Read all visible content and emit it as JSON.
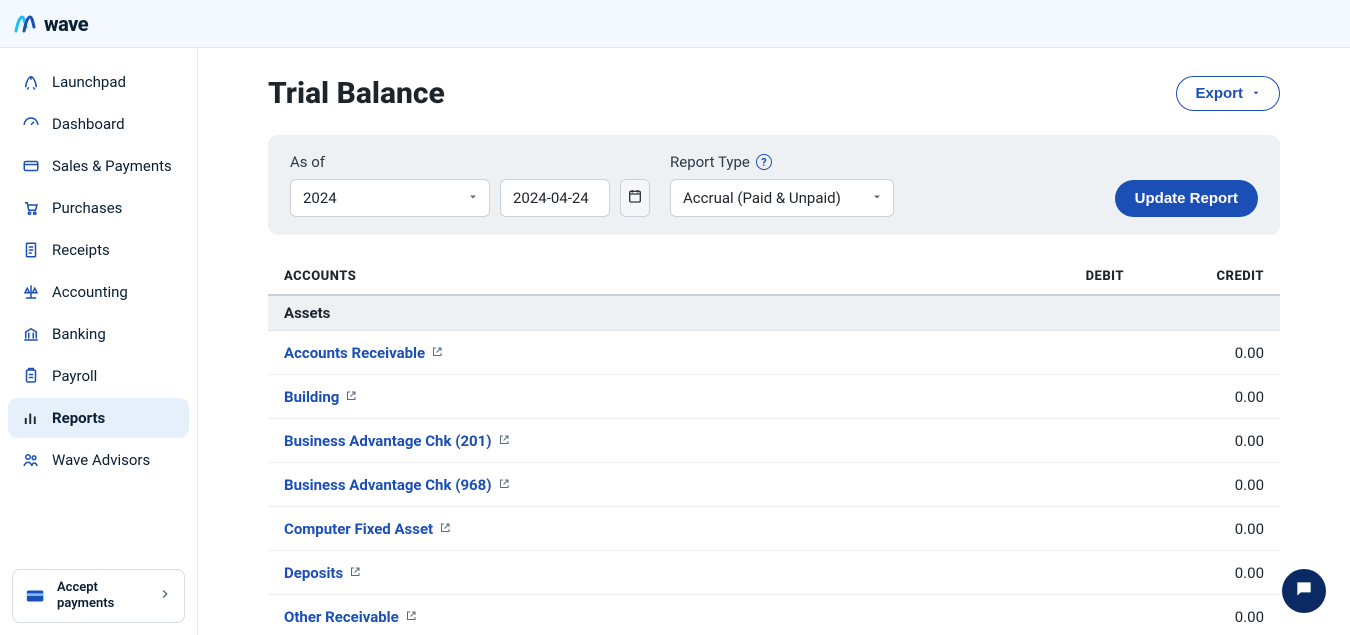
{
  "brand": {
    "name": "wave"
  },
  "sidebar": {
    "items": [
      {
        "label": "Launchpad",
        "icon": "rocket-icon"
      },
      {
        "label": "Dashboard",
        "icon": "gauge-icon"
      },
      {
        "label": "Sales & Payments",
        "icon": "card-icon"
      },
      {
        "label": "Purchases",
        "icon": "cart-icon"
      },
      {
        "label": "Receipts",
        "icon": "receipt-icon"
      },
      {
        "label": "Accounting",
        "icon": "scale-icon"
      },
      {
        "label": "Banking",
        "icon": "bank-icon"
      },
      {
        "label": "Payroll",
        "icon": "clipboard-icon"
      },
      {
        "label": "Reports",
        "icon": "bar-chart-icon",
        "active": true
      },
      {
        "label": "Wave Advisors",
        "icon": "people-icon"
      }
    ],
    "promo": {
      "line1": "Accept",
      "line2": "payments"
    }
  },
  "page": {
    "title": "Trial Balance",
    "export_label": "Export"
  },
  "filters": {
    "as_of_label": "As of",
    "year_value": "2024",
    "date_value": "2024-04-24",
    "report_type_label": "Report Type",
    "report_type_value": "Accrual (Paid & Unpaid)",
    "update_label": "Update Report"
  },
  "table": {
    "headers": {
      "accounts": "ACCOUNTS",
      "debit": "DEBIT",
      "credit": "CREDIT"
    },
    "sections": [
      {
        "title": "Assets",
        "rows": [
          {
            "name": "Accounts Receivable",
            "debit": "",
            "credit": "0.00"
          },
          {
            "name": "Building",
            "debit": "",
            "credit": "0.00"
          },
          {
            "name": "Business Advantage Chk (201)",
            "debit": "",
            "credit": "0.00"
          },
          {
            "name": "Business Advantage Chk (968)",
            "debit": "",
            "credit": "0.00"
          },
          {
            "name": "Computer Fixed Asset",
            "debit": "",
            "credit": "0.00"
          },
          {
            "name": "Deposits",
            "debit": "",
            "credit": "0.00"
          },
          {
            "name": "Other Receivable",
            "debit": "",
            "credit": "0.00"
          }
        ]
      }
    ]
  }
}
